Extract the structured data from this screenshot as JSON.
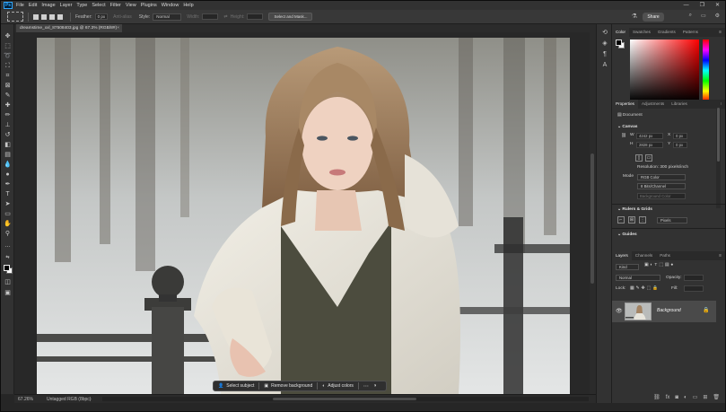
{
  "app": {
    "logo": "Ps",
    "menu": [
      "File",
      "Edit",
      "Image",
      "Layer",
      "Type",
      "Select",
      "Filter",
      "View",
      "Plugins",
      "Window",
      "Help"
    ],
    "window_controls": [
      "—",
      "❐",
      "✕"
    ]
  },
  "options": {
    "feather_label": "Feather:",
    "feather_value": "0 px",
    "antialias": "Anti-alias",
    "style_label": "Style:",
    "style_value": "Normal",
    "width_label": "Width:",
    "height_label": "Height:",
    "select_mask": "Select and Mask...",
    "share": "Share"
  },
  "document": {
    "tab_title": "dreamstime_xxl_87508403.jpg @ 67.3% (RGB/8#)",
    "close": "×"
  },
  "taskbar": {
    "select_subject": "Select subject",
    "remove_background": "Remove background",
    "adjust_colors": "Adjust colors"
  },
  "status": {
    "zoom": "67.26%",
    "info": "Untagged RGB (8bpc)",
    "chevron": "›"
  },
  "panels": {
    "color_tabs": [
      "Color",
      "Swatches",
      "Gradients",
      "Patterns"
    ],
    "props_tabs": [
      "Properties",
      "Adjustments",
      "Libraries"
    ],
    "doc_label": "Document",
    "canvas_head": "Canvas",
    "w_label": "W",
    "w_value": "4242 px",
    "h_label": "H",
    "h_value": "2828 px",
    "x_label": "X",
    "x_value": "0 px",
    "y_label": "Y",
    "y_value": "0 px",
    "resolution": "Resolution: 300 pixels/inch",
    "mode_label": "Mode",
    "mode_value": "RGB Color",
    "bits_value": "8 Bits/Channel",
    "bg_label": "Background Color",
    "rulers_head": "Rulers & Grids",
    "units_value": "Pixels",
    "guides_head": "Guides",
    "layers_tabs": [
      "Layers",
      "Channels",
      "Paths"
    ],
    "kind_label": "Kind",
    "blend_value": "Normal",
    "opacity_label": "Opacity:",
    "lock_label": "Lock:",
    "fill_label": "Fill:",
    "layer_name": "Background"
  },
  "colors": {
    "accent": "#31a8ff",
    "ui_dark": "#323232",
    "canvas_bg": "#282828"
  }
}
